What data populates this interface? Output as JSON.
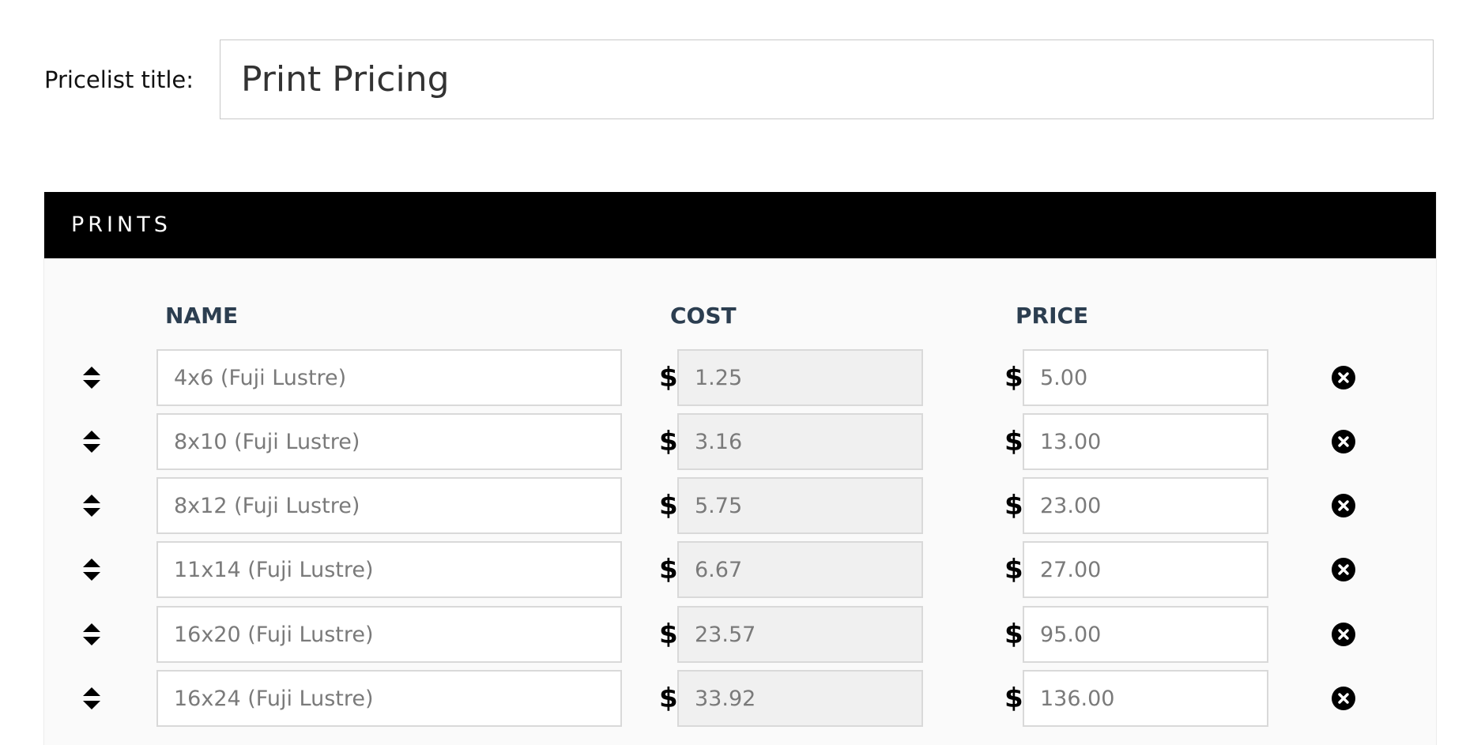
{
  "pricelist": {
    "label": "Pricelist title:",
    "value": "Print Pricing"
  },
  "section": {
    "title": "PRINTS",
    "columns": {
      "name": "NAME",
      "cost": "COST",
      "price": "PRICE"
    },
    "currency": "$",
    "rows": [
      {
        "name": "4x6 (Fuji Lustre)",
        "cost": "1.25",
        "price": "5.00"
      },
      {
        "name": "8x10 (Fuji Lustre)",
        "cost": "3.16",
        "price": "13.00"
      },
      {
        "name": "8x12 (Fuji Lustre)",
        "cost": "5.75",
        "price": "23.00"
      },
      {
        "name": "11x14 (Fuji Lustre)",
        "cost": "6.67",
        "price": "27.00"
      },
      {
        "name": "16x20 (Fuji Lustre)",
        "cost": "23.57",
        "price": "95.00"
      },
      {
        "name": "16x24 (Fuji Lustre)",
        "cost": "33.92",
        "price": "136.00"
      }
    ]
  },
  "icons": {
    "drag": "sort-arrows-icon",
    "remove": "remove-circle-icon"
  },
  "colors": {
    "header_bg": "#000000",
    "column_heading": "#2c3e50",
    "readonly_bg": "#f0f0f0"
  }
}
